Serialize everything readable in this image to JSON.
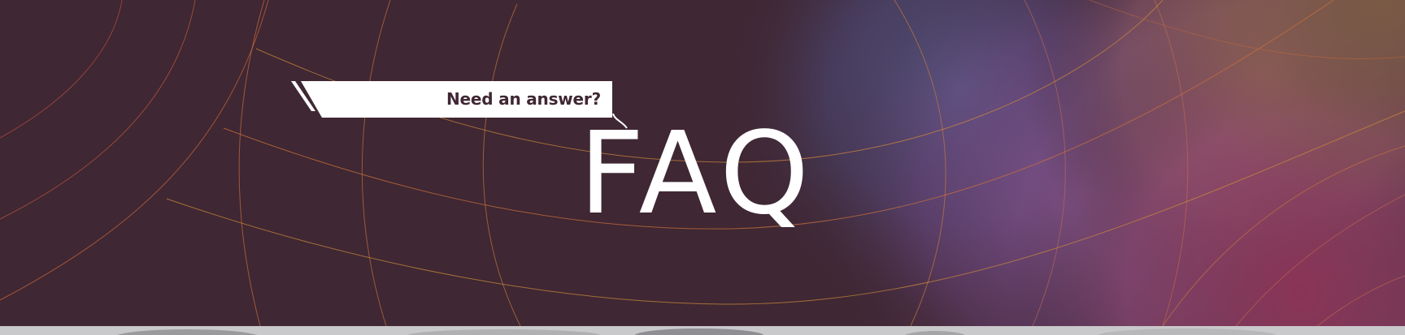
{
  "hero": {
    "tagline": "Need an answer?",
    "title": "FAQ"
  },
  "colors": {
    "background": "#3f2733",
    "title": "#ffffff",
    "tagline_text": "#3f2733",
    "banner": "#ffffff",
    "grid_lines": "#c8783c",
    "glow_blue": "#5a5a96",
    "glow_pink": "#b4466e",
    "glow_orange": "#b4784b",
    "bottom_strip": "#c9c8ca"
  }
}
